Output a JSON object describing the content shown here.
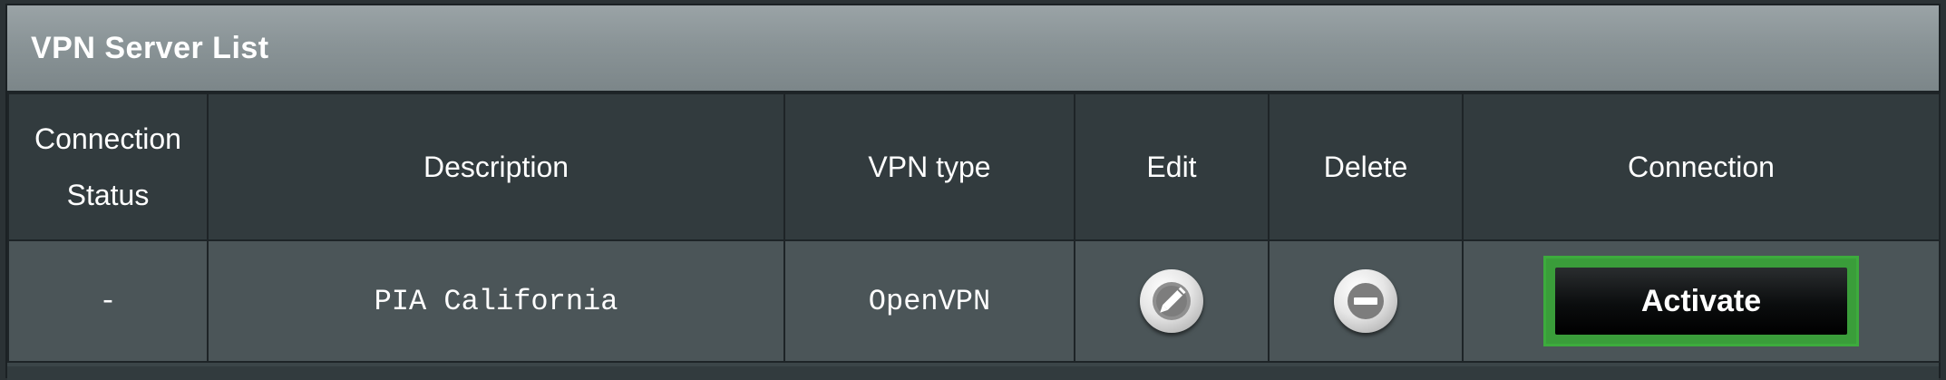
{
  "panel": {
    "title": "VPN Server List"
  },
  "table": {
    "headers": {
      "status": "Connection\nStatus",
      "description": "Description",
      "vpn_type": "VPN type",
      "edit": "Edit",
      "delete": "Delete",
      "connection": "Connection"
    },
    "rows": [
      {
        "status": "-",
        "description": "PIA California",
        "vpn_type": "OpenVPN",
        "edit_icon": "pencil-icon",
        "delete_icon": "minus-circle-icon",
        "connection_label": "Activate"
      }
    ]
  },
  "colors": {
    "title_bar": "#8a9497",
    "header_bg": "#323b3e",
    "row_bg": "#4b5558",
    "activate_highlight": "#3dab3d",
    "activate_button": "#000000"
  }
}
